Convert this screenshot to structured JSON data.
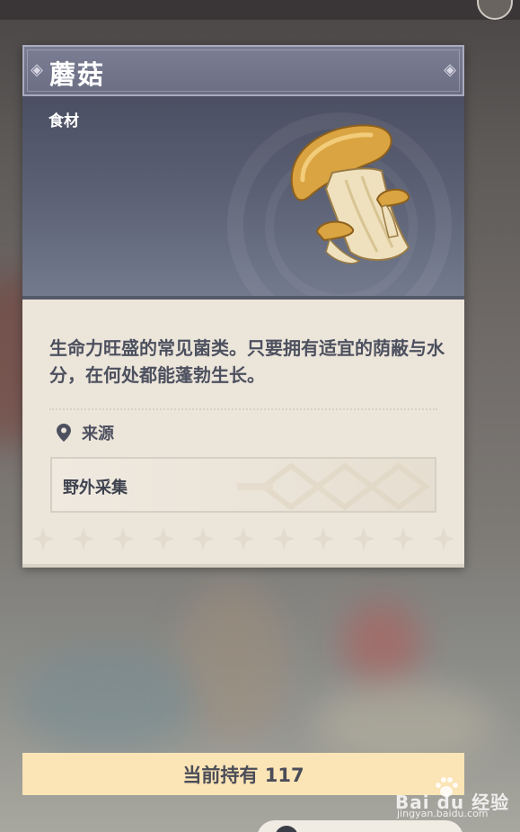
{
  "item": {
    "name": "蘑菇",
    "category": "食材",
    "image_icon": "mushroom-icon",
    "description": "生命力旺盛的常见菌类。只要拥有适宜的荫蔽与水分，在何处都能蓬勃生长。",
    "source_label": "来源",
    "source_icon": "location-pin-icon",
    "sources": [
      "野外采集"
    ]
  },
  "holding": {
    "text": "当前持有 117"
  },
  "watermark": {
    "brand": "Bai du 经验",
    "url": "jingyan.baidu.com"
  },
  "colors": {
    "title_bar": "#6c6f84",
    "header_bg": "#5a5f73",
    "card_bg": "#ece5da",
    "text_dark": "#4d515f",
    "holding_bg": "#fbe4b5"
  }
}
